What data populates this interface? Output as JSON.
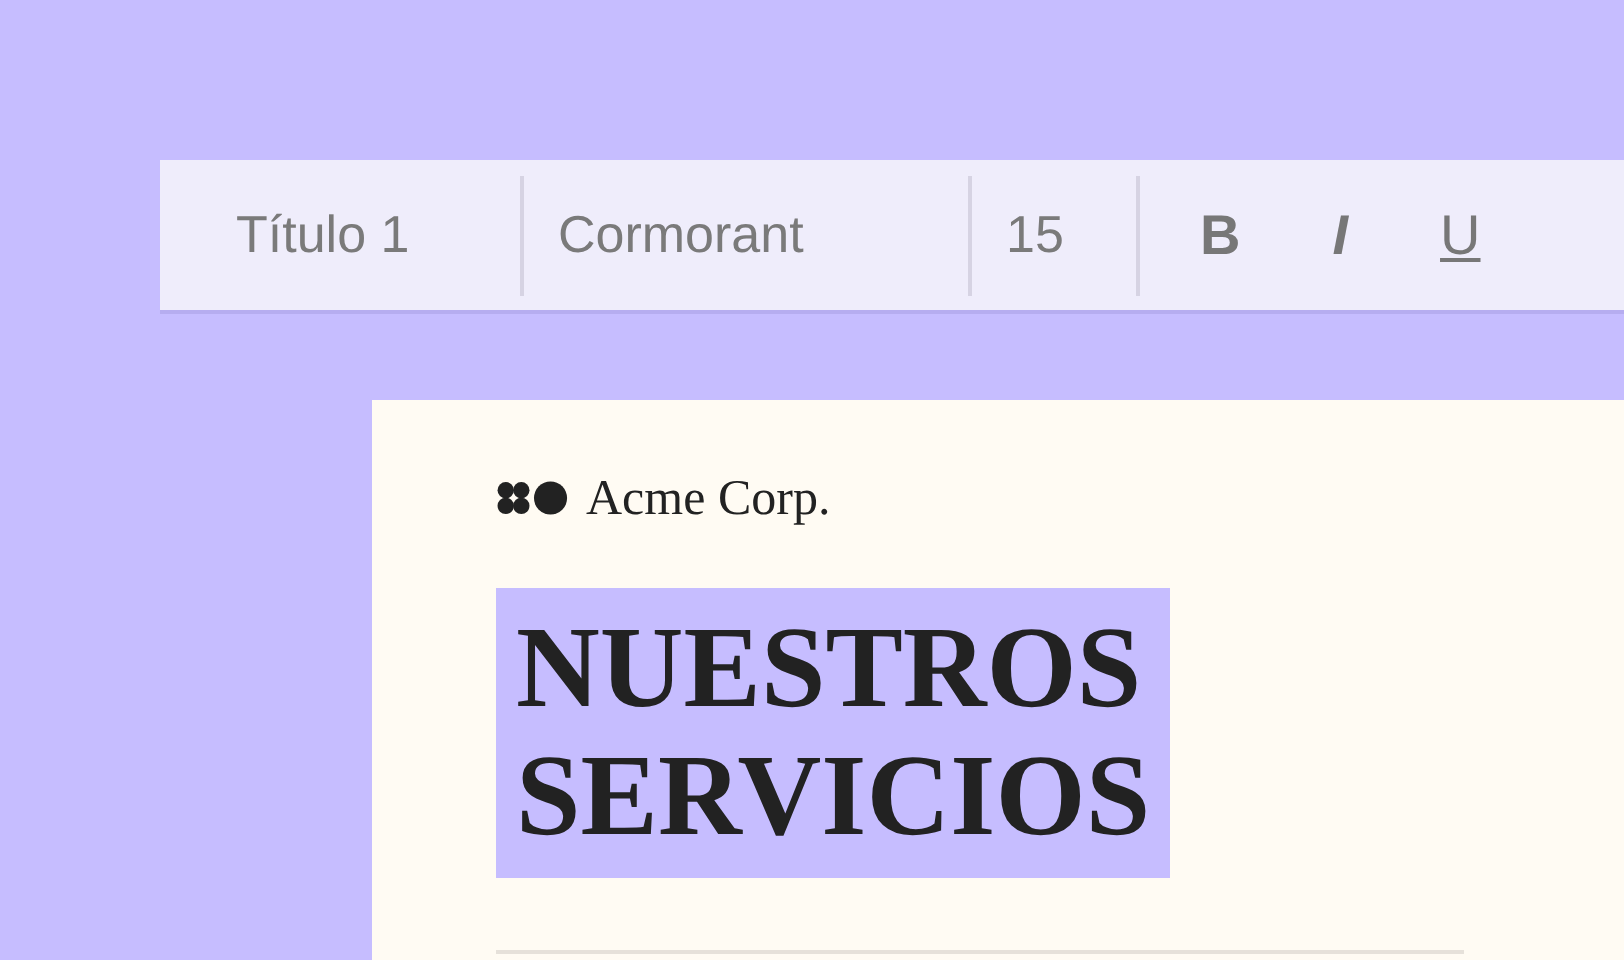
{
  "toolbar": {
    "style": "Título 1",
    "font": "Cormorant",
    "size": "15",
    "format_buttons": [
      {
        "kind": "bold",
        "label": "B"
      },
      {
        "kind": "italic",
        "label": "I"
      },
      {
        "kind": "underline",
        "label": "U"
      }
    ]
  },
  "document": {
    "brand": "Acme Corp.",
    "heading": [
      "NUESTROS",
      "SERVICIOS"
    ],
    "heading_highlighted": true
  }
}
